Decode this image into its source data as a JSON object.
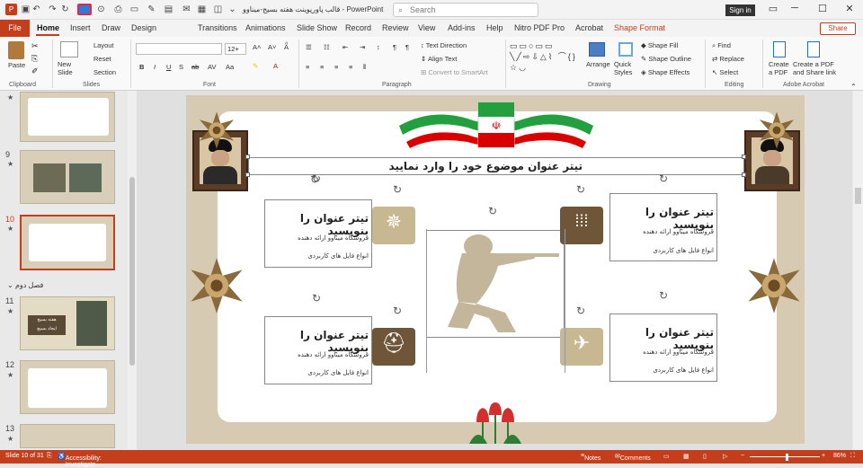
{
  "app": {
    "title": "قالب پاورپوینت هفته بسیج-میناوو  -  PowerPoint",
    "search_placeholder": "Search",
    "signin_label": "Sign in"
  },
  "tabs": [
    "File",
    "Home",
    "Insert",
    "Draw",
    "Design",
    "Transitions",
    "Animations",
    "Slide Show",
    "Record",
    "Review",
    "View",
    "Add-ins",
    "Help",
    "Nitro PDF Pro",
    "Acrobat",
    "Shape Format"
  ],
  "share_label": "Share",
  "ribbon": {
    "clipboard": {
      "paste": "Paste",
      "group": "Clipboard"
    },
    "slides": {
      "new_slide": "New Slide",
      "layout": "Layout",
      "reset": "Reset",
      "section": "Section",
      "group": "Slides"
    },
    "font": {
      "font_size": "12+",
      "group": "Font"
    },
    "paragraph": {
      "text_direction": "Text Direction",
      "align_text": "Align Text",
      "convert_smartart": "Convert to SmartArt",
      "group": "Paragraph"
    },
    "drawing": {
      "arrange": "Arrange",
      "quick_styles": "Quick Styles",
      "shape_fill": "Shape Fill",
      "shape_outline": "Shape Outline",
      "shape_effects": "Shape Effects",
      "group": "Drawing"
    },
    "editing": {
      "find": "Find",
      "replace": "Replace",
      "select": "Select",
      "group": "Editing"
    },
    "acrobat": {
      "create_pdf": "Create a PDF",
      "create_share": "Create a PDF and Share link",
      "group": "Adobe Acrobat"
    }
  },
  "thumbnails": {
    "items": [
      {
        "num": "",
        "star": "★"
      },
      {
        "num": "9",
        "star": "★"
      },
      {
        "num": "10",
        "star": "★"
      },
      {
        "num": "11",
        "star": "★"
      },
      {
        "num": "12",
        "star": "★"
      },
      {
        "num": "13",
        "star": "★"
      }
    ],
    "section_label": "فصل دوم",
    "thumb11_line1": "هفته بسیج",
    "thumb11_line2": "ایجاد بسیج"
  },
  "slide": {
    "main_title": "تیتر عنوان  موضوع خود را وارد نمایید",
    "cards": [
      {
        "title": "تیتر عنوان را بنویسید",
        "line1": "فروشگاه میناوو ارائه دهنده",
        "line2": "انواع فایل های کاربردی"
      },
      {
        "title": "تیتر عنوان را بنویسید",
        "line1": "فروشگاه میناوو ارائه دهنده",
        "line2": "انواع فایل های کاربردی"
      },
      {
        "title": "تیتر عنوان را بنویسید",
        "line1": "فروشگاه میناوو ارائه دهنده",
        "line2": "انواع فایل های کاربردی"
      },
      {
        "title": "تیتر عنوان را بنویسید",
        "line1": "فروشگاه میناوو ارائه دهنده",
        "line2": "انواع فایل های کاربردی"
      }
    ]
  },
  "statusbar": {
    "slide_info": "Slide 10 of 31",
    "accessibility": "Accessibility: Investigate",
    "notes": "Notes",
    "comments": "Comments",
    "zoom": "86%"
  },
  "colors": {
    "accent": "#c43e1c",
    "slide_bg": "#d6cbb2",
    "icon_dark": "#6f5639",
    "icon_light": "#c8b892"
  }
}
